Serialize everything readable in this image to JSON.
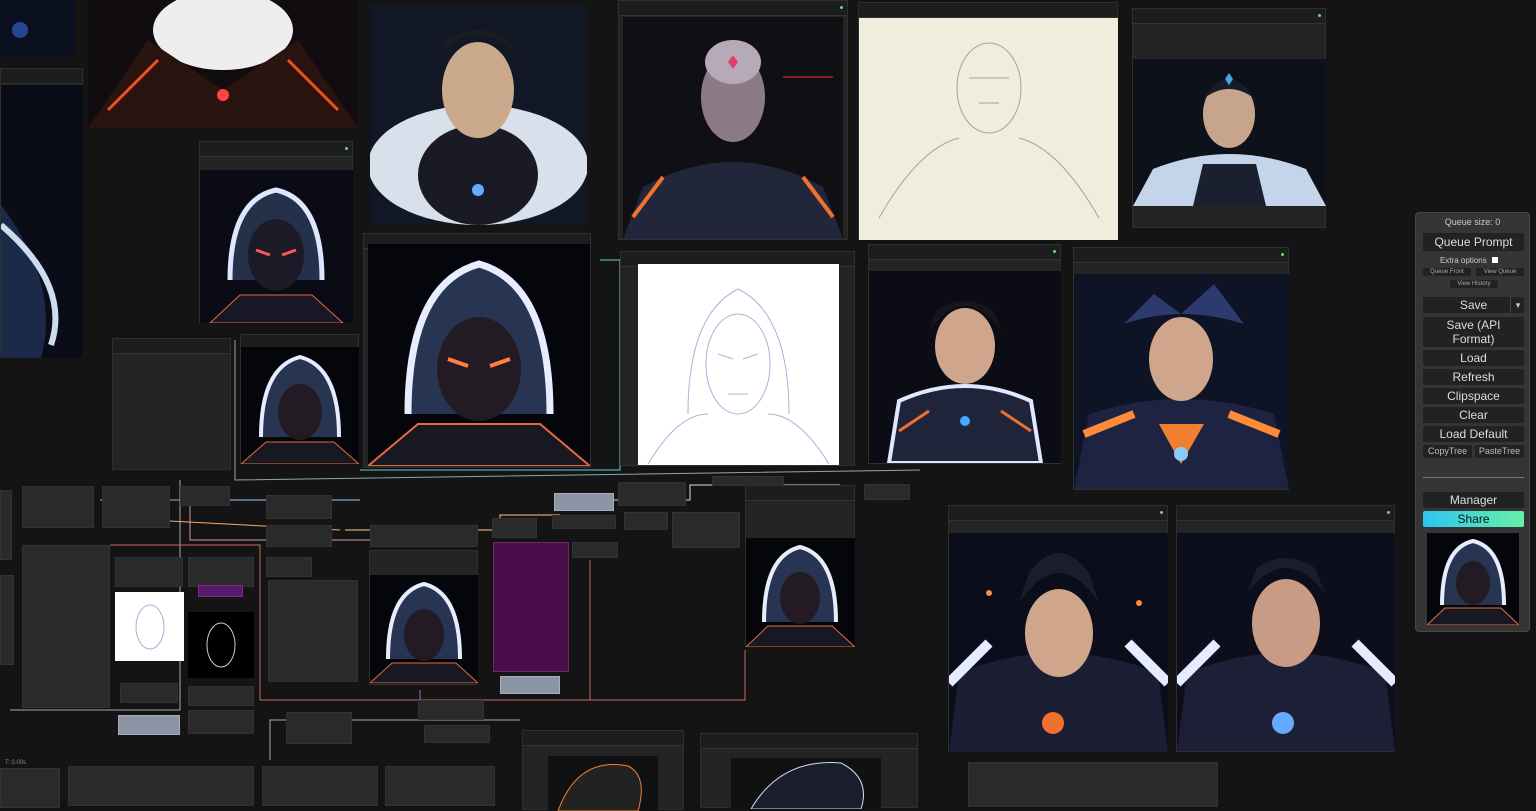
{
  "panel": {
    "queue_size_label": "Queue size: 0",
    "queue_prompt": "Queue Prompt",
    "extra_options": "Extra options",
    "queue_front": "Queue Front",
    "view_queue": "View Queue",
    "view_history": "View History",
    "save": "Save",
    "save_dropdown": "▾",
    "save_api": "Save (API Format)",
    "load": "Load",
    "refresh": "Refresh",
    "clipspace": "Clipspace",
    "clear": "Clear",
    "load_default": "Load Default",
    "copy_tree": "CopyTree",
    "paste_tree": "PasteTree",
    "manager": "Manager",
    "share": "Share"
  },
  "status": {
    "timer": "T: 0.00s"
  },
  "colors": {
    "canvas_bg": "#141414",
    "node_bg": "#242424",
    "share_start": "#2ec4f2",
    "share_end": "#66f0a8",
    "purple_node": "#4a0f4a"
  }
}
